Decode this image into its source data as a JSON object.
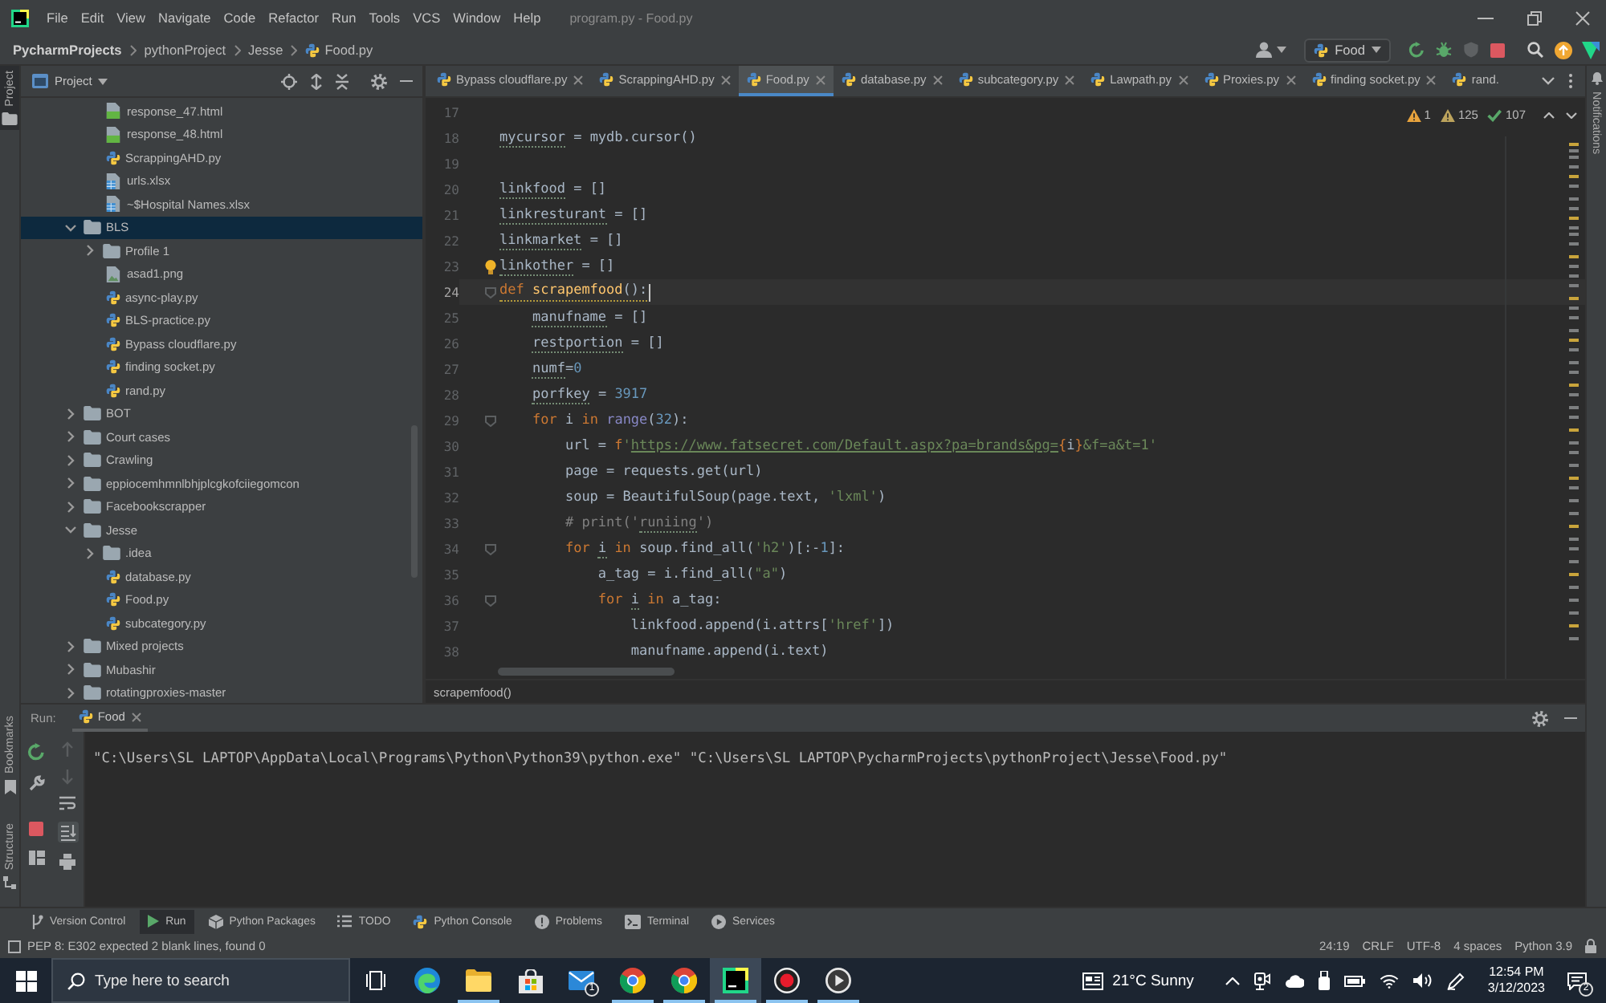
{
  "title_bar": {
    "menu": [
      "File",
      "Edit",
      "View",
      "Navigate",
      "Code",
      "Refactor",
      "Run",
      "Tools",
      "VCS",
      "Window",
      "Help"
    ],
    "title": "program.py - Food.py"
  },
  "navigation_bar": {
    "breadcrumbs": [
      "PycharmProjects",
      "pythonProject",
      "Jesse",
      "Food.py"
    ],
    "run_configuration": "Food",
    "actions": [
      {
        "disabled": false
      },
      {
        "disabled": false
      },
      {
        "disabled": true
      },
      {
        "disabled": false
      }
    ]
  },
  "left_stripe": [
    {
      "label": "Project",
      "selected": true
    },
    {
      "label": "Bookmarks",
      "selected": false
    },
    {
      "label": "Structure",
      "selected": false
    }
  ],
  "right_stripe": [
    {
      "label": "Notifications",
      "selected": false
    }
  ],
  "project_panel": {
    "title": "Project",
    "continued_children": [
      {
        "name": "response_47.html",
        "kind": "html",
        "selected": false
      },
      {
        "name": "response_48.html",
        "kind": "html",
        "selected": false
      },
      {
        "name": "ScrappingAHD.py",
        "kind": "python",
        "selected": false
      },
      {
        "name": "urls.xlsx",
        "kind": "spreadsheet",
        "selected": false
      },
      {
        "name": "~$Hospital Names.xlsx",
        "kind": "spreadsheet",
        "selected": false
      }
    ],
    "tree": [
      {
        "name": "BLS",
        "kind": "folder",
        "expanded": true,
        "selected": true,
        "children": [
          {
            "name": "Profile 1",
            "kind": "folder",
            "expanded": false,
            "selected": false
          },
          {
            "name": "asad1.png",
            "kind": "image",
            "selected": false
          },
          {
            "name": "async-play.py",
            "kind": "python",
            "selected": false
          },
          {
            "name": "BLS-practice.py",
            "kind": "python",
            "selected": false
          },
          {
            "name": "Bypass cloudflare.py",
            "kind": "python",
            "selected": false
          },
          {
            "name": "finding socket.py",
            "kind": "python",
            "selected": false
          },
          {
            "name": "rand.py",
            "kind": "python",
            "selected": false
          }
        ]
      },
      {
        "name": "BOT",
        "kind": "folder",
        "expanded": false,
        "selected": false
      },
      {
        "name": "Court cases",
        "kind": "folder",
        "expanded": false,
        "selected": false
      },
      {
        "name": "Crawling",
        "kind": "folder",
        "expanded": false,
        "selected": false
      },
      {
        "name": "eppiocemhmnlbhjplcgkofciiegomcon",
        "kind": "folder",
        "expanded": false,
        "selected": false
      },
      {
        "name": "Facebookscrapper",
        "kind": "folder",
        "expanded": false,
        "selected": false
      },
      {
        "name": "Jesse",
        "kind": "folder",
        "expanded": true,
        "selected": false,
        "children": [
          {
            "name": ".idea",
            "kind": "folder",
            "expanded": false,
            "selected": false
          },
          {
            "name": "database.py",
            "kind": "python",
            "selected": false
          },
          {
            "name": "Food.py",
            "kind": "python",
            "selected": false
          },
          {
            "name": "subcategory.py",
            "kind": "python",
            "selected": false
          }
        ]
      },
      {
        "name": "Mixed projects",
        "kind": "folder",
        "expanded": false,
        "selected": false
      },
      {
        "name": "Mubashir",
        "kind": "folder",
        "expanded": false,
        "selected": false
      },
      {
        "name": "rotatingproxies-master",
        "kind": "folder",
        "expanded": false,
        "selected": false
      }
    ]
  },
  "editor_tabs": [
    {
      "label": "Bypass cloudflare.py",
      "selected": false
    },
    {
      "label": "ScrappingAHD.py",
      "selected": false
    },
    {
      "label": "Food.py",
      "selected": true
    },
    {
      "label": "database.py",
      "selected": false
    },
    {
      "label": "subcategory.py",
      "selected": false
    },
    {
      "label": "Lawpath.py",
      "selected": false
    },
    {
      "label": "Proxies.py",
      "selected": false
    },
    {
      "label": "finding socket.py",
      "selected": false
    },
    {
      "label": "rand.",
      "selected": false
    }
  ],
  "inspections": {
    "warning_count": "1",
    "weak_warning_count": "125",
    "typo_count": "107"
  },
  "editor": {
    "lines": [
      {
        "number": "17",
        "current": false,
        "fold": false,
        "bulb": false,
        "flagged": false
      },
      {
        "number": "18",
        "current": false,
        "fold": false,
        "bulb": false,
        "flagged": false,
        "tokens": [
          {
            "kind": "unused",
            "text": "mycursor"
          },
          {
            "kind": "plain",
            "text": " = mydb.cursor()"
          }
        ]
      },
      {
        "number": "19",
        "current": false,
        "fold": false,
        "bulb": false,
        "flagged": false
      },
      {
        "number": "20",
        "current": false,
        "fold": false,
        "bulb": false,
        "flagged": false,
        "tokens": [
          {
            "kind": "unused",
            "text": "linkfood"
          },
          {
            "kind": "plain",
            "text": " = []"
          }
        ]
      },
      {
        "number": "21",
        "current": false,
        "fold": false,
        "bulb": false,
        "flagged": false,
        "tokens": [
          {
            "kind": "unused",
            "text": "linkresturant"
          },
          {
            "kind": "plain",
            "text": " = []"
          }
        ]
      },
      {
        "number": "22",
        "current": false,
        "fold": false,
        "bulb": false,
        "flagged": false,
        "tokens": [
          {
            "kind": "unused",
            "text": "linkmarket"
          },
          {
            "kind": "plain",
            "text": " = []"
          }
        ]
      },
      {
        "number": "23",
        "current": false,
        "fold": false,
        "bulb": true,
        "flagged": false,
        "tokens": [
          {
            "kind": "unused",
            "text": "linkother"
          },
          {
            "kind": "plain",
            "text": " = []"
          }
        ]
      },
      {
        "number": "24",
        "current": true,
        "fold": true,
        "bulb": false,
        "flagged": true,
        "tokens": [
          {
            "kind": "keyword",
            "text": "def "
          },
          {
            "kind": "function",
            "text": "scrapemfood"
          },
          {
            "kind": "plain",
            "text": "():"
          }
        ]
      },
      {
        "number": "25",
        "current": false,
        "fold": false,
        "bulb": false,
        "flagged": false,
        "tokens": [
          {
            "kind": "unused",
            "text": "    manufname"
          },
          {
            "kind": "plain",
            "text": " = []"
          }
        ]
      },
      {
        "number": "26",
        "current": false,
        "fold": false,
        "bulb": false,
        "flagged": false,
        "tokens": [
          {
            "kind": "unused",
            "text": "    restportion"
          },
          {
            "kind": "plain",
            "text": " = []"
          }
        ]
      },
      {
        "number": "27",
        "current": false,
        "fold": false,
        "bulb": false,
        "flagged": false,
        "tokens": [
          {
            "kind": "unused",
            "text": "    numf"
          },
          {
            "kind": "plain",
            "text": "="
          },
          {
            "kind": "number",
            "text": "0"
          }
        ]
      },
      {
        "number": "28",
        "current": false,
        "fold": false,
        "bulb": false,
        "flagged": false,
        "tokens": [
          {
            "kind": "unused",
            "text": "    porfkey"
          },
          {
            "kind": "plain",
            "text": " = "
          },
          {
            "kind": "number",
            "text": "3917"
          }
        ]
      },
      {
        "number": "29",
        "current": false,
        "fold": true,
        "bulb": false,
        "flagged": false,
        "tokens": [
          {
            "kind": "keyword",
            "text": "    for"
          },
          {
            "kind": "plain",
            "text": " i "
          },
          {
            "kind": "keyword",
            "text": "in "
          },
          {
            "kind": "builtin",
            "text": "range"
          },
          {
            "kind": "plain",
            "text": "("
          },
          {
            "kind": "number",
            "text": "32"
          },
          {
            "kind": "plain",
            "text": "):"
          }
        ]
      },
      {
        "number": "30",
        "current": false,
        "fold": false,
        "bulb": false,
        "flagged": false,
        "tokens": [
          {
            "kind": "plain",
            "text": "        url = "
          },
          {
            "kind": "keyword",
            "text": "f"
          },
          {
            "kind": "string",
            "text": "'"
          },
          {
            "kind": "link",
            "text": "https://www.fatsecret.com/Default.aspx?pa=brands&pg="
          },
          {
            "kind": "brace",
            "text": "{"
          },
          {
            "kind": "plain",
            "text": "i"
          },
          {
            "kind": "brace",
            "text": "}"
          },
          {
            "kind": "string",
            "text": "&f=a&t=1'"
          }
        ]
      },
      {
        "number": "31",
        "current": false,
        "fold": false,
        "bulb": false,
        "flagged": false,
        "tokens": [
          {
            "kind": "plain",
            "text": "        page = requests.get(url)"
          }
        ]
      },
      {
        "number": "32",
        "current": false,
        "fold": false,
        "bulb": false,
        "flagged": false,
        "tokens": [
          {
            "kind": "plain",
            "text": "        soup = BeautifulSoup(page.text, "
          },
          {
            "kind": "string",
            "text": "'lxml'"
          },
          {
            "kind": "plain",
            "text": ")"
          }
        ]
      },
      {
        "number": "33",
        "current": false,
        "fold": false,
        "bulb": false,
        "flagged": false,
        "tokens": [
          {
            "kind": "comment",
            "text": "        # print('"
          },
          {
            "kind": "comment_typo",
            "text": "runiing"
          },
          {
            "kind": "comment",
            "text": "')"
          }
        ]
      },
      {
        "number": "34",
        "current": false,
        "fold": true,
        "bulb": false,
        "flagged": false,
        "tokens": [
          {
            "kind": "keyword",
            "text": "        for "
          },
          {
            "kind": "unused",
            "text": "i"
          },
          {
            "kind": "keyword",
            "text": " in"
          },
          {
            "kind": "plain",
            "text": " soup.find_all("
          },
          {
            "kind": "string",
            "text": "'h2'"
          },
          {
            "kind": "plain",
            "text": ")[:-"
          },
          {
            "kind": "number",
            "text": "1"
          },
          {
            "kind": "plain",
            "text": "]:"
          }
        ]
      },
      {
        "number": "35",
        "current": false,
        "fold": false,
        "bulb": false,
        "flagged": false,
        "tokens": [
          {
            "kind": "plain",
            "text": "            a_tag = i.find_all("
          },
          {
            "kind": "string",
            "text": "\"a\""
          },
          {
            "kind": "plain",
            "text": ")"
          }
        ]
      },
      {
        "number": "36",
        "current": false,
        "fold": true,
        "bulb": false,
        "flagged": false,
        "tokens": [
          {
            "kind": "keyword",
            "text": "            for "
          },
          {
            "kind": "unused",
            "text": "i"
          },
          {
            "kind": "keyword",
            "text": " in"
          },
          {
            "kind": "plain",
            "text": " a_tag:"
          }
        ]
      },
      {
        "number": "37",
        "current": false,
        "fold": false,
        "bulb": false,
        "flagged": false,
        "tokens": [
          {
            "kind": "plain",
            "text": "                linkfood.append(i.attrs["
          },
          {
            "kind": "string",
            "text": "'href'"
          },
          {
            "kind": "plain",
            "text": "])"
          }
        ]
      },
      {
        "number": "38",
        "current": false,
        "fold": false,
        "bulb": false,
        "flagged": false,
        "tokens": [
          {
            "kind": "plain",
            "text": "                manufname.append(i.text)"
          }
        ]
      }
    ]
  },
  "editor_breadcrumb": "scrapemfood()",
  "run_panel": {
    "title": "Run:",
    "tabs": [
      {
        "label": "Food",
        "selected": true
      }
    ],
    "primary_toolbar": [
      {
        "disabled": false
      },
      {
        "disabled": false
      },
      {
        "disabled": false
      },
      {
        "disabled": false
      }
    ],
    "secondary_toolbar": [
      {
        "disabled": true,
        "on": false
      },
      {
        "disabled": true,
        "on": false
      },
      {
        "disabled": false,
        "on": false
      },
      {
        "disabled": false,
        "on": true
      },
      {
        "disabled": false,
        "on": false
      }
    ],
    "output": "\"C:\\Users\\SL LAPTOP\\AppData\\Local\\Programs\\Python\\Python39\\python.exe\" \"C:\\Users\\SL LAPTOP\\PycharmProjects\\pythonProject\\Jesse\\Food.py\""
  },
  "tool_window_bar": [
    {
      "label": "Version Control",
      "selected": false
    },
    {
      "label": "Run",
      "selected": true
    },
    {
      "label": "Python Packages",
      "selected": false
    },
    {
      "label": "TODO",
      "selected": false
    },
    {
      "label": "Python Console",
      "selected": false
    },
    {
      "label": "Problems",
      "selected": false
    },
    {
      "label": "Terminal",
      "selected": false
    },
    {
      "label": "Services",
      "selected": false
    }
  ],
  "status_bar": {
    "message": "PEP 8: E302 expected 2 blank lines, found 0",
    "widgets": [
      "24:19",
      "CRLF",
      "UTF-8",
      "4 spaces",
      "Python 3.9"
    ]
  },
  "taskbar": {
    "search": {
      "placeholder": "Type here to search"
    },
    "apps": [
      {
        "selected": false,
        "running": false
      },
      {
        "selected": false,
        "running": true
      },
      {
        "selected": false,
        "running": false
      },
      {
        "selected": false,
        "running": false,
        "badge": "1"
      },
      {
        "selected": false,
        "running": true
      },
      {
        "selected": false,
        "running": true
      },
      {
        "selected": true,
        "running": true
      },
      {
        "selected": false,
        "running": true
      },
      {
        "selected": false,
        "running": true
      }
    ],
    "weather": "21°C Sunny",
    "time": "12:54 PM",
    "date": "3/12/2023",
    "notification_count": "2"
  }
}
